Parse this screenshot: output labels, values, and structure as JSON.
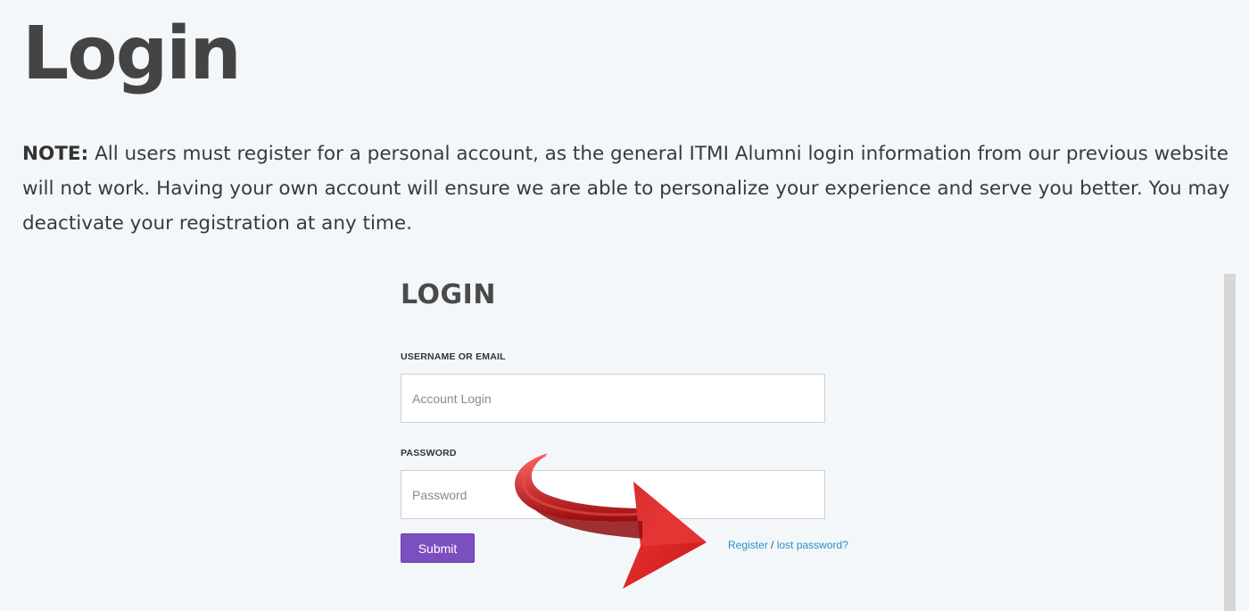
{
  "page": {
    "title": "Login",
    "note_label": "NOTE:",
    "note_text": " All users must register for a personal account, as the general ITMI Alumni login information from our previous website will not work. Having your own account will ensure we are able to personalize your experience and serve you better. You may deactivate your registration at any time."
  },
  "login_form": {
    "heading": "LOGIN",
    "username_label": "USERNAME OR EMAIL",
    "username_placeholder": "Account Login",
    "password_label": "PASSWORD",
    "password_placeholder": "Password",
    "submit_label": "Submit",
    "register_link": "Register",
    "separator": " / ",
    "lost_password_link": "lost password?"
  },
  "colors": {
    "background": "#f3f7fa",
    "submit_button": "#7b4fbf",
    "link": "#2a8fc4",
    "arrow": "#d42020"
  },
  "icons": {
    "annotation": "red-curved-arrow-icon"
  }
}
